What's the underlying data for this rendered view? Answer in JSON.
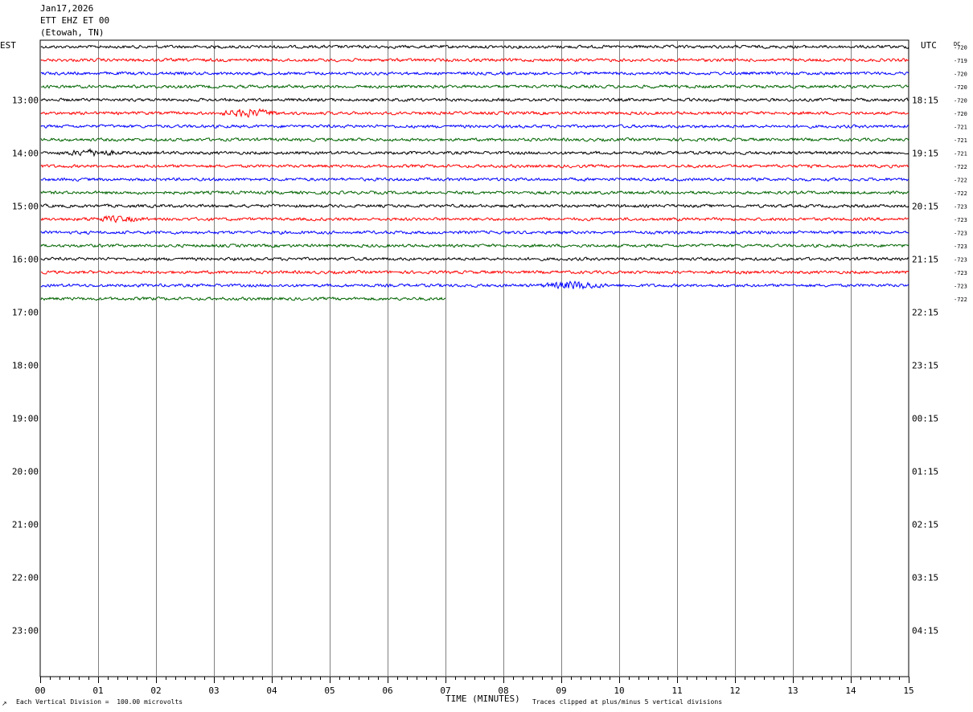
{
  "header": {
    "date": "Jan17,2026",
    "station": "ETT EHZ ET 00",
    "location": "(Etowah, TN)"
  },
  "axes": {
    "left_tz": "EST",
    "right_tz": "UTC",
    "dc_label": "DC",
    "xlabel": "TIME (MINUTES)"
  },
  "footer": {
    "left_note": "Each Vertical Division =  100.00 microvolts",
    "right_note": "Traces clipped at plus/minus 5 vertical divisions",
    "corner_mark": "↗"
  },
  "chart_data": {
    "type": "line",
    "title": "",
    "xlabel": "TIME (MINUTES)",
    "ylabel": "",
    "x_ticks": [
      "00",
      "01",
      "02",
      "03",
      "04",
      "05",
      "06",
      "07",
      "08",
      "09",
      "10",
      "11",
      "12",
      "13",
      "14",
      "15"
    ],
    "xlim": [
      0,
      15
    ],
    "grid": true,
    "row_minutes": 15,
    "total_rows": 48,
    "colors": [
      "#000000",
      "#ff0000",
      "#0000ff",
      "#006400"
    ],
    "left_hour_labels": [
      "13:00",
      "14:00",
      "15:00",
      "16:00",
      "17:00",
      "18:00",
      "19:00",
      "20:00",
      "21:00",
      "22:00",
      "23:00"
    ],
    "right_hour_labels": [
      "18:15",
      "19:15",
      "20:15",
      "21:15",
      "22:15",
      "23:15",
      "00:15",
      "01:15",
      "02:15",
      "03:15",
      "04:15"
    ],
    "hour_label_start_row": 4,
    "dc_offsets": [
      "-720",
      "-719",
      "-720",
      "-720",
      "-720",
      "-720",
      "-721",
      "-721",
      "-721",
      "-722",
      "-722",
      "-722",
      "-723",
      "-723",
      "-723",
      "-723",
      "-723",
      "-723",
      "-723",
      "-722"
    ],
    "traces_end_minutes": [
      15,
      15,
      15,
      15,
      15,
      15,
      15,
      15,
      15,
      15,
      15,
      15,
      15,
      15,
      15,
      15,
      15,
      15,
      15,
      7
    ],
    "events": [
      {
        "row": 5,
        "minute": 3.6,
        "amplitude": 2.2
      },
      {
        "row": 8,
        "minute": 0.9,
        "amplitude": 1.6
      },
      {
        "row": 13,
        "minute": 1.3,
        "amplitude": 1.3
      },
      {
        "row": 18,
        "minute": 9.2,
        "amplitude": 2.4
      }
    ]
  }
}
